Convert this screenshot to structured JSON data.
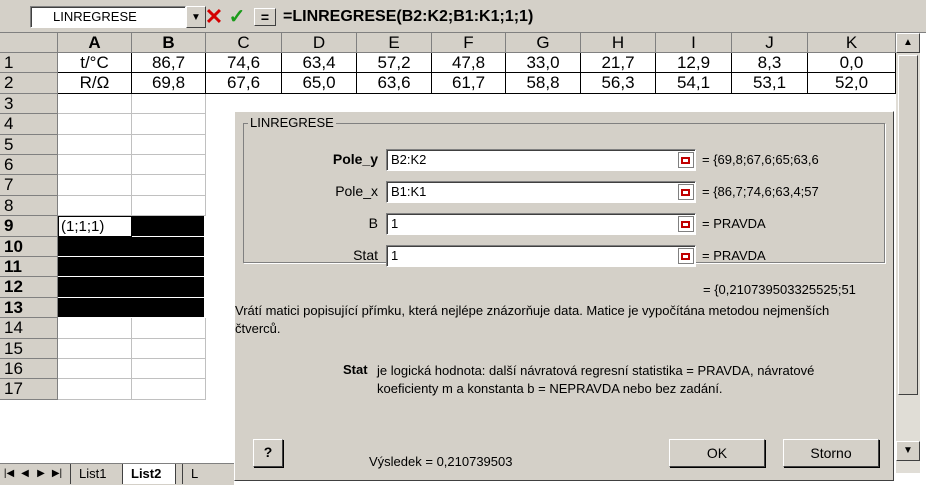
{
  "formula_bar": {
    "name_box": "LINREGRESE",
    "dropdown_glyph": "▼",
    "cancel_glyph": "✕",
    "enter_glyph": "✓",
    "equal_glyph": "=",
    "formula": "=LINREGRESE(B2:K2;B1:K1;1;1)"
  },
  "columns": [
    "A",
    "B",
    "C",
    "D",
    "E",
    "F",
    "G",
    "H",
    "I",
    "J",
    "K"
  ],
  "rows": [
    "1",
    "2",
    "3",
    "4",
    "5",
    "6",
    "7",
    "8",
    "9",
    "10",
    "11",
    "12",
    "13",
    "14",
    "15",
    "16",
    "17"
  ],
  "sheet": {
    "row1": [
      "t/°C",
      "86,7",
      "74,6",
      "63,4",
      "57,2",
      "47,8",
      "33,0",
      "21,7",
      "12,9",
      "8,3",
      "0,0"
    ],
    "row2": [
      "R/Ω",
      "69,8",
      "67,6",
      "65,0",
      "63,6",
      "61,7",
      "58,8",
      "56,3",
      "54,1",
      "53,1",
      "52,0"
    ],
    "a9": "(1;1;1)"
  },
  "dialog": {
    "title": "LINREGRESE",
    "args": [
      {
        "label": "Pole_y",
        "value": "B2:K2",
        "result": "= {69,8;67,6;65;63,6"
      },
      {
        "label": "Pole_x",
        "value": "B1:K1",
        "result": "= {86,7;74,6;63,4;57"
      },
      {
        "label": "B",
        "value": "1",
        "result": "= PRAVDA"
      },
      {
        "label": "Stat",
        "value": "1",
        "result": "= PRAVDA"
      }
    ],
    "overall_result": "= {0,210739503325525;51",
    "description": "Vrátí matici popisující přímku, která nejlépe znázorňuje data. Matice je vypočítána metodou nejmenších čtverců.",
    "help_arg_name": "Stat",
    "help_arg_text": "je logická hodnota: další návratová regresní statistika = PRAVDA, návratové koeficienty m a konstanta b = NEPRAVDA nebo bez zadání.",
    "result_line": "Výsledek = 0,210739503",
    "ok_label": "OK",
    "cancel_label": "Storno",
    "help_icon": "question-icon"
  },
  "tabs": {
    "items": [
      "List1",
      "List2",
      "L"
    ],
    "active": "List2"
  }
}
